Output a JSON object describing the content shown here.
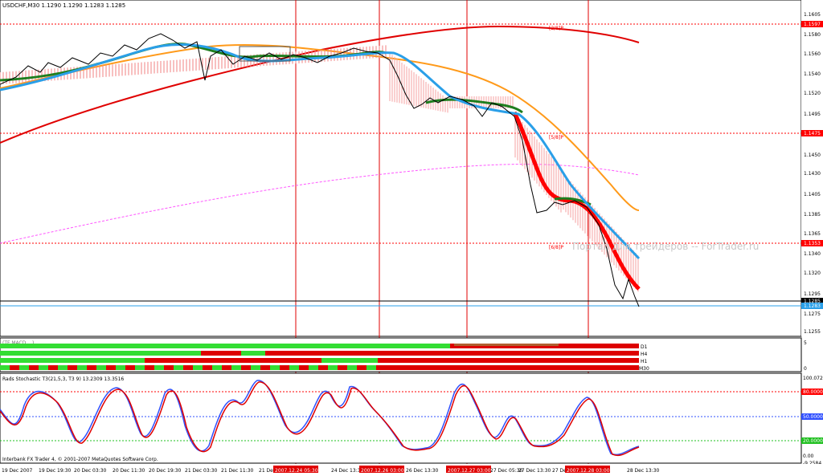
{
  "main_chart": {
    "symbol_header": "USDCHF,M30  1.1290 1.1290 1.1283 1.1285",
    "price_axis": [
      "1.1605",
      "1.1580",
      "1.1560",
      "1.1540",
      "1.1520",
      "1.1495",
      "1.1450",
      "1.1430",
      "1.1405",
      "1.1385",
      "1.1365",
      "1.1340",
      "1.1320",
      "1.1295",
      "1.1275",
      "1.1255"
    ],
    "levels": [
      {
        "value": "1.1597",
        "tag": "[2/8]P",
        "color": "#ff0000"
      },
      {
        "value": "1.1475",
        "tag": "[5/8]P",
        "color": "#ff0000"
      },
      {
        "value": "1.1353",
        "tag": "[6/8]P",
        "color": "#ff0000"
      }
    ],
    "current_price_label": "1.1283",
    "current_price_label_2": "1.1285",
    "watermark": "Портал для трейдеров -- ForTrader.ru",
    "colors": {
      "red_ma": "#e00000",
      "orange_ma": "#ff9a1a",
      "blue_ma": "#2a9fe8",
      "magenta_ma": "#ff55ff",
      "green_band": "#1e7e1e",
      "price": "#000000",
      "grid_line": "#e00000"
    }
  },
  "mtf_panel": {
    "axis_top": "5",
    "axis_bottom": "0",
    "labels": [
      "D1",
      "H4",
      "H1",
      "M30"
    ],
    "title_hint": "(TF MACD ...)"
  },
  "stoch_panel": {
    "title": "Rads Stochastic T3(21,5,3, T3 9) 13.2309 13.3516",
    "axis": [
      "100.0720",
      "80.0000",
      "50.0000",
      "20.0000",
      "0.00",
      "-9.2584"
    ],
    "copyright": "Interbank FX Trader 4, © 2001-2007 MetaQuotes Software Corp."
  },
  "time_axis": {
    "ticks": [
      "19 Dec 2007",
      "19 Dec 19:30",
      "20 Dec 03:30",
      "20 Dec 11:30",
      "20 Dec 19:30",
      "21 Dec 03:30",
      "21 Dec 11:30",
      "21 Dec 19:30",
      "24 Dec 13:30",
      "26 Dec 13:30",
      "27 Dec 05:30",
      "27 Dec 13:30",
      "27 Dec 21:30",
      "28 Dec 13:30"
    ],
    "highlights": [
      "2007.12.24 05:30",
      "2007.12.26 03:00",
      "2007.12.27 03:00",
      "2007.12.28 03:00"
    ]
  }
}
